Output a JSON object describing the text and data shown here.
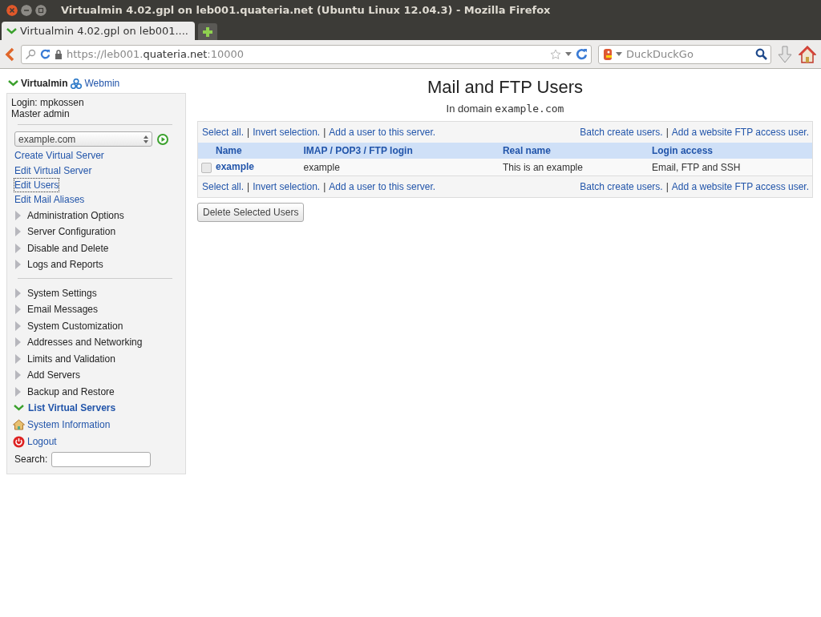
{
  "window": {
    "title": "Virtualmin 4.02.gpl on leb001.quateria.net (Ubuntu Linux 12.04.3) - Mozilla Firefox"
  },
  "tabs": [
    {
      "label": "Virtualmin 4.02.gpl on leb001....",
      "selected": true
    }
  ],
  "address_bar": {
    "url_prefix": "https://leb001.",
    "url_host": "quateria.net",
    "url_suffix": ":10000"
  },
  "search_bar": {
    "placeholder": "DuckDuckGo"
  },
  "sidebar": {
    "module_tabs": [
      {
        "label": "Virtualmin",
        "selected": true
      },
      {
        "label": "Webmin",
        "selected": false
      }
    ],
    "login": "Login: mpkossen",
    "role": "Master admin",
    "domain_select": "example.com",
    "links": [
      {
        "label": "Create Virtual Server",
        "focused": false
      },
      {
        "label": "Edit Virtual Server",
        "focused": false
      },
      {
        "label": "Edit Users",
        "focused": true
      },
      {
        "label": "Edit Mail Aliases",
        "focused": false
      }
    ],
    "categories": [
      {
        "label": "Administration Options",
        "expanded": false
      },
      {
        "label": "Server Configuration",
        "expanded": false
      },
      {
        "label": "Disable and Delete",
        "expanded": false
      },
      {
        "label": "Logs and Reports",
        "expanded": false
      }
    ],
    "categories_2": [
      {
        "label": "System Settings",
        "expanded": false
      },
      {
        "label": "Email Messages",
        "expanded": false
      },
      {
        "label": "System Customization",
        "expanded": false
      },
      {
        "label": "Addresses and Networking",
        "expanded": false
      },
      {
        "label": "Limits and Validation",
        "expanded": false
      },
      {
        "label": "Add Servers",
        "expanded": false
      },
      {
        "label": "Backup and Restore",
        "expanded": false
      },
      {
        "label": "List Virtual Servers",
        "expanded": true
      }
    ],
    "actions": [
      {
        "label": "System Information",
        "kind": "home"
      },
      {
        "label": "Logout",
        "kind": "logout"
      }
    ],
    "search_label": "Search:"
  },
  "main": {
    "title": "Mail and FTP Users",
    "subtitle_prefix": "In domain",
    "subtitle_domain": "example.com",
    "top_links": {
      "left": [
        {
          "kind": "link",
          "text": "Select all."
        },
        {
          "kind": "separator",
          "text": "|"
        },
        {
          "kind": "link",
          "text": "Invert selection."
        },
        {
          "kind": "separator",
          "text": "|"
        },
        {
          "kind": "link",
          "text": "Add a user to this server."
        }
      ],
      "right": [
        {
          "kind": "link",
          "text": "Batch create users."
        },
        {
          "kind": "separator",
          "text": "|"
        },
        {
          "kind": "link",
          "text": "Add a website FTP access user."
        }
      ]
    },
    "bottom_links": {
      "left": [
        {
          "kind": "link",
          "text": "Select all."
        },
        {
          "kind": "separator",
          "text": "|"
        },
        {
          "kind": "link",
          "text": "Invert selection."
        },
        {
          "kind": "separator",
          "text": "|"
        },
        {
          "kind": "link",
          "text": "Add a user to this server."
        }
      ],
      "right": [
        {
          "kind": "link",
          "text": "Batch create users."
        },
        {
          "kind": "separator",
          "text": "|"
        },
        {
          "kind": "link",
          "text": "Add a website FTP access user."
        }
      ]
    },
    "table": {
      "columns": [
        "Name",
        "IMAP / POP3 / FTP login",
        "Real name",
        "Login access"
      ],
      "rows": [
        {
          "checked": false,
          "cells": [
            "example",
            "example",
            "This is an example",
            "Email, FTP and SSH"
          ]
        }
      ]
    },
    "button": "Delete Selected Users"
  }
}
